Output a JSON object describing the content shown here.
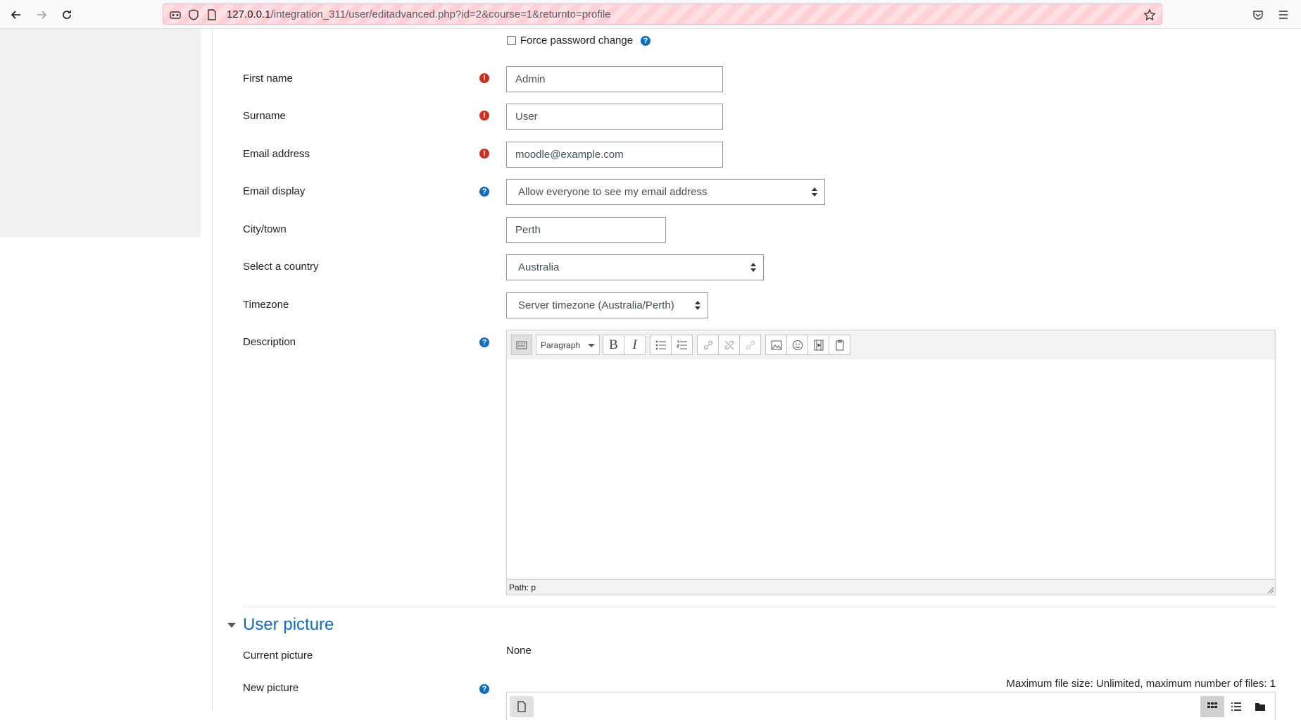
{
  "browser": {
    "url_host": "127.0.0.1",
    "url_path": "/integration_311/user/editadvanced.php?id=2&course=1&returnto=profile"
  },
  "form": {
    "force_password_change_label": "Force password change",
    "first_name": {
      "label": "First name",
      "value": "Admin"
    },
    "surname": {
      "label": "Surname",
      "value": "User"
    },
    "email": {
      "label": "Email address",
      "value": "moodle@example.com"
    },
    "email_display": {
      "label": "Email display",
      "value": "Allow everyone to see my email address"
    },
    "city": {
      "label": "City/town",
      "value": "Perth"
    },
    "country": {
      "label": "Select a country",
      "value": "Australia"
    },
    "timezone": {
      "label": "Timezone",
      "value": "Server timezone (Australia/Perth)"
    },
    "description": {
      "label": "Description",
      "format": "Paragraph",
      "path": "Path: p"
    }
  },
  "user_picture": {
    "section_title": "User picture",
    "current_label": "Current picture",
    "current_value": "None",
    "new_label": "New picture",
    "limits": "Maximum file size: Unlimited, maximum number of files: 1"
  },
  "colors": {
    "accent": "#0f6cbf",
    "required": "#ca3120"
  }
}
